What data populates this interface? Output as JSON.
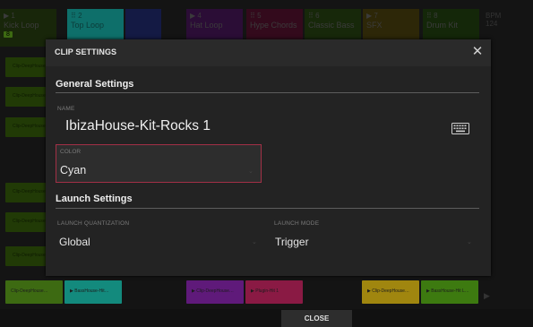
{
  "tracks": [
    {
      "num": "▶ 1",
      "name": "Kick Loop",
      "badge": "8",
      "color": "#2e4d10"
    },
    {
      "num": "⠿ 2",
      "name": "Top Loop",
      "badge": "",
      "color": "#0e6f6a"
    },
    {
      "num": "",
      "name": "",
      "badge": "",
      "color": "#1a1e5a"
    },
    {
      "num": "▶ 4",
      "name": "Hat Loop",
      "badge": "",
      "color": "#4a1458"
    },
    {
      "num": "⠿ 5",
      "name": "Hype Chords",
      "badge": "",
      "color": "#5a1030"
    },
    {
      "num": "⠿ 6",
      "name": "Classic Bass",
      "badge": "",
      "color": "#223d0d"
    },
    {
      "num": "▶ 7",
      "name": "SFX",
      "badge": "",
      "color": "#5a4a0a"
    },
    {
      "num": "⠿ 8",
      "name": "Drum Kit",
      "badge": "",
      "color": "#1f3d0c"
    }
  ],
  "header_right": {
    "bpm_label": "BPM",
    "bpm_value": "124"
  },
  "left_clips": [
    "Clip-DeepHouse",
    "Clip-DeepHouse",
    "Clip-DeepHouse",
    "Clip-DeepHouse",
    "Clip-DeepHouse",
    "Clip-DeepHouse"
  ],
  "bottom_clips": [
    {
      "label": "Clip-DeepHouse…",
      "color": "#3d6a12"
    },
    {
      "label": "▶ BassHouse-Hit…",
      "color": "#138a7d"
    },
    {
      "label": "",
      "color": "#1a1a1a"
    },
    {
      "label": "▶ Clip-DeepHouse…",
      "color": "#5f1a7a"
    },
    {
      "label": "▶ Plugin-Hit 1",
      "color": "#8a1a44"
    },
    {
      "label": "",
      "color": "#1a1a1a"
    },
    {
      "label": "▶ Clip-DeepHouse…",
      "color": "#a0860f"
    },
    {
      "label": "▶ BassHouse-Hit L…",
      "color": "#3d7a10"
    }
  ],
  "dialog": {
    "title": "CLIP SETTINGS",
    "close_icon": "close-icon",
    "general_title": "General Settings",
    "name_label": "NAME",
    "name_value": "IbizaHouse-Kit-Rocks 1",
    "keyboard_icon": "keyboard-icon",
    "color_label": "COLOR",
    "color_value": "Cyan",
    "launch_title": "Launch Settings",
    "quant_label": "LAUNCH QUANTIZATION",
    "quant_value": "Global",
    "mode_label": "LAUNCH MODE",
    "mode_value": "Trigger",
    "accent": "#a23046"
  },
  "footer": {
    "close_label": "CLOSE"
  }
}
